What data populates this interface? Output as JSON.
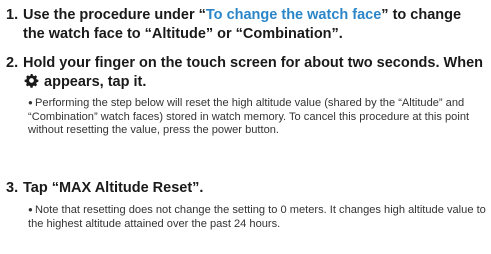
{
  "steps": [
    {
      "number": "1.",
      "text_before": "Use the procedure under “",
      "link": "To change the watch face",
      "text_after": "” to change the watch face to “Altitude” or “Combination”."
    },
    {
      "number": "2.",
      "text_before_icon": "Hold your finger on the touch screen for about two seconds. When ",
      "icon": "gear-icon",
      "text_after_icon": " appears, tap it.",
      "note_bullet": "●",
      "note": "Performing the step below will reset the high altitude value (shared by the “Altitude” and “Combination” watch faces) stored in watch memory. To cancel this procedure at this point without resetting the value, press the power button."
    },
    {
      "number": "3.",
      "text": "Tap “MAX Altitude Reset”.",
      "note_bullet": "●",
      "note": "Note that resetting does not change the setting to 0 meters. It changes high altitude value to the highest altitude attained over the past 24 hours."
    }
  ],
  "colors": {
    "link": "#2a86c8",
    "text": "#1a1a1a",
    "note": "#333333"
  }
}
